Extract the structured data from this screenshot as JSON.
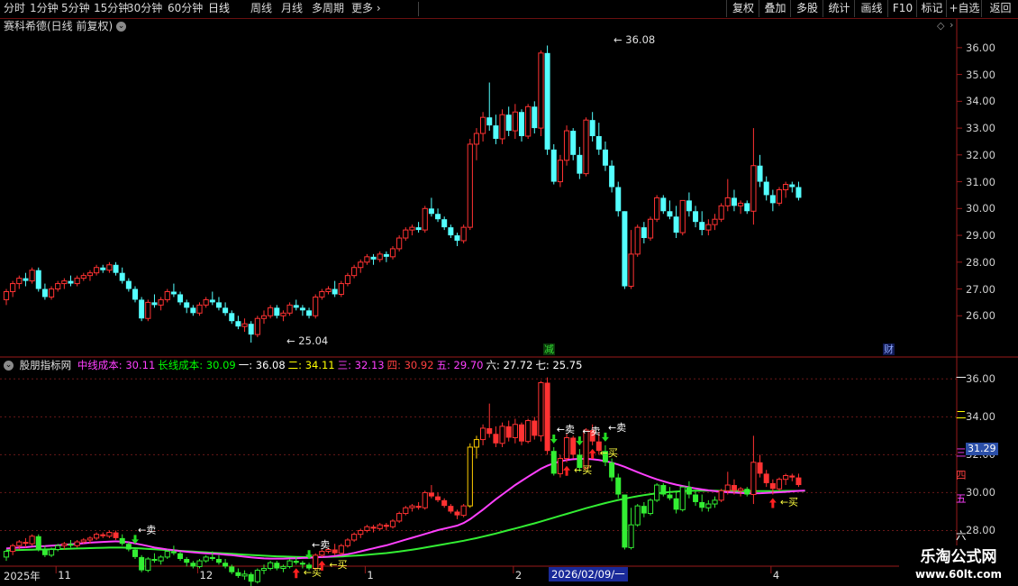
{
  "toolbar": {
    "periods": [
      "分时",
      "1分钟",
      "5分钟",
      "15分钟",
      "30分钟",
      "60分钟",
      "日线",
      "周线",
      "月线",
      "多周期",
      "更多"
    ],
    "active_period": "日线",
    "more_arrow": "›",
    "right_buttons": [
      "复权",
      "叠加",
      "多股",
      "统计",
      "画线",
      "F10",
      "标记",
      "+自选",
      "返回"
    ]
  },
  "main_panel": {
    "title": "赛科希德(日线 前复权)",
    "high_label": "36.08",
    "low_label": "25.04",
    "y_ticks": [
      "36.00",
      "35.00",
      "34.00",
      "33.00",
      "32.00",
      "31.00",
      "30.00",
      "29.00",
      "28.00",
      "27.00",
      "26.00"
    ],
    "event_tags": [
      "减",
      "财"
    ]
  },
  "indicator_panel": {
    "name": "股朋指标网",
    "values": [
      {
        "label": "中线成本:",
        "value": "30.11",
        "color": "#ff40ff"
      },
      {
        "label": "长线成本:",
        "value": "30.09",
        "color": "#00ff00"
      },
      {
        "label": "一:",
        "value": "36.08",
        "color": "#ffffff"
      },
      {
        "label": "二:",
        "value": "34.11",
        "color": "#ffff00"
      },
      {
        "label": "三:",
        "value": "32.13",
        "color": "#ff40ff"
      },
      {
        "label": "四:",
        "value": "30.92",
        "color": "#ff4040"
      },
      {
        "label": "五:",
        "value": "29.70",
        "color": "#ff40ff"
      },
      {
        "label": "六:",
        "value": "27.72",
        "color": "#ffffff"
      },
      {
        "label": "七:",
        "value": "25.75",
        "color": "#ffffff"
      }
    ],
    "y_ticks": [
      "36.00",
      "34.00",
      "32.00",
      "30.00",
      "28.00"
    ],
    "level_labels": [
      "一",
      "二",
      "三",
      "四",
      "五",
      "六"
    ],
    "current_price_badge": "31.29",
    "buy_label": "买",
    "sell_label": "卖"
  },
  "x_axis": {
    "labels": [
      "2025年",
      "11",
      "12",
      "1",
      "2",
      "4"
    ],
    "cursor_date": "2026/02/09/一"
  },
  "watermark": {
    "line1": "乐淘公式网",
    "line2": "www.60lt.com"
  },
  "colors": {
    "up": "#ff3232",
    "down": "#54ffff",
    "mid_cost": "#ff40ff",
    "long_cost": "#33ee33",
    "grid_red": "#8a1a1a",
    "axis_text": "#d0d0d0"
  },
  "chart_data": {
    "type": "candlestick",
    "ohlc": [
      [
        26.6,
        27.0,
        26.4,
        26.9
      ],
      [
        26.9,
        27.3,
        26.7,
        27.2
      ],
      [
        27.2,
        27.5,
        27.0,
        27.4
      ],
      [
        27.4,
        27.6,
        27.1,
        27.3
      ],
      [
        27.3,
        27.8,
        27.2,
        27.7
      ],
      [
        27.7,
        27.8,
        26.9,
        27.0
      ],
      [
        27.0,
        27.2,
        26.6,
        26.7
      ],
      [
        26.7,
        27.1,
        26.6,
        27.0
      ],
      [
        27.0,
        27.3,
        26.9,
        27.2
      ],
      [
        27.2,
        27.4,
        27.0,
        27.3
      ],
      [
        27.3,
        27.5,
        27.1,
        27.2
      ],
      [
        27.2,
        27.5,
        27.1,
        27.4
      ],
      [
        27.4,
        27.6,
        27.3,
        27.5
      ],
      [
        27.5,
        27.7,
        27.3,
        27.6
      ],
      [
        27.6,
        27.9,
        27.5,
        27.8
      ],
      [
        27.8,
        27.9,
        27.6,
        27.7
      ],
      [
        27.7,
        28.0,
        27.6,
        27.9
      ],
      [
        27.9,
        28.0,
        27.5,
        27.6
      ],
      [
        27.6,
        27.8,
        27.2,
        27.3
      ],
      [
        27.3,
        27.4,
        26.9,
        27.0
      ],
      [
        27.0,
        27.1,
        26.5,
        26.6
      ],
      [
        26.6,
        26.7,
        25.8,
        25.9
      ],
      [
        25.9,
        26.6,
        25.8,
        26.5
      ],
      [
        26.5,
        26.8,
        26.3,
        26.4
      ],
      [
        26.4,
        26.7,
        26.2,
        26.6
      ],
      [
        26.6,
        27.0,
        26.5,
        26.9
      ],
      [
        26.9,
        27.2,
        26.7,
        26.8
      ],
      [
        26.8,
        26.9,
        26.4,
        26.5
      ],
      [
        26.5,
        26.6,
        26.1,
        26.3
      ],
      [
        26.3,
        26.4,
        26.0,
        26.1
      ],
      [
        26.1,
        26.5,
        26.0,
        26.4
      ],
      [
        26.4,
        26.7,
        26.3,
        26.6
      ],
      [
        26.6,
        26.9,
        26.4,
        26.5
      ],
      [
        26.5,
        26.7,
        26.2,
        26.3
      ],
      [
        26.3,
        26.5,
        26.0,
        26.1
      ],
      [
        26.1,
        26.2,
        25.7,
        25.8
      ],
      [
        25.8,
        26.0,
        25.5,
        25.6
      ],
      [
        25.6,
        25.9,
        25.4,
        25.7
      ],
      [
        25.7,
        25.8,
        25.0,
        25.3
      ],
      [
        25.3,
        26.0,
        25.2,
        25.9
      ],
      [
        25.9,
        26.2,
        25.7,
        26.0
      ],
      [
        26.0,
        26.4,
        25.9,
        26.3
      ],
      [
        26.3,
        26.4,
        25.9,
        26.0
      ],
      [
        26.0,
        26.2,
        25.8,
        26.1
      ],
      [
        26.1,
        26.5,
        26.0,
        26.4
      ],
      [
        26.4,
        26.6,
        26.2,
        26.3
      ],
      [
        26.3,
        26.4,
        26.0,
        26.2
      ],
      [
        26.2,
        26.3,
        25.9,
        26.0
      ],
      [
        26.0,
        26.8,
        25.9,
        26.7
      ],
      [
        26.7,
        27.0,
        26.6,
        26.9
      ],
      [
        26.9,
        27.1,
        26.8,
        27.0
      ],
      [
        27.0,
        27.3,
        26.7,
        26.8
      ],
      [
        26.8,
        27.3,
        26.7,
        27.2
      ],
      [
        27.2,
        27.6,
        27.1,
        27.5
      ],
      [
        27.5,
        27.9,
        27.4,
        27.8
      ],
      [
        27.8,
        28.1,
        27.6,
        28.0
      ],
      [
        28.0,
        28.3,
        27.9,
        28.2
      ],
      [
        28.2,
        28.3,
        27.9,
        28.1
      ],
      [
        28.1,
        28.4,
        28.0,
        28.3
      ],
      [
        28.3,
        28.4,
        28.0,
        28.2
      ],
      [
        28.2,
        28.6,
        28.1,
        28.5
      ],
      [
        28.5,
        29.0,
        28.4,
        28.9
      ],
      [
        28.9,
        29.3,
        28.8,
        29.2
      ],
      [
        29.2,
        29.4,
        29.0,
        29.3
      ],
      [
        29.3,
        29.5,
        29.1,
        29.2
      ],
      [
        29.2,
        30.1,
        29.1,
        30.0
      ],
      [
        30.0,
        30.4,
        29.7,
        29.8
      ],
      [
        29.8,
        30.0,
        29.5,
        29.6
      ],
      [
        29.6,
        29.7,
        29.2,
        29.3
      ],
      [
        29.3,
        29.4,
        28.9,
        29.0
      ],
      [
        29.0,
        29.1,
        28.6,
        28.8
      ],
      [
        28.8,
        29.4,
        28.7,
        29.3
      ],
      [
        29.3,
        32.6,
        29.2,
        32.4
      ],
      [
        32.4,
        33.0,
        31.8,
        32.8
      ],
      [
        32.8,
        33.6,
        32.5,
        33.4
      ],
      [
        33.4,
        34.7,
        32.9,
        33.1
      ],
      [
        33.1,
        33.5,
        32.4,
        32.6
      ],
      [
        32.6,
        33.7,
        32.4,
        33.5
      ],
      [
        33.5,
        33.8,
        32.7,
        32.9
      ],
      [
        32.9,
        33.9,
        32.6,
        33.6
      ],
      [
        33.6,
        33.7,
        32.5,
        32.7
      ],
      [
        32.7,
        33.9,
        32.6,
        33.8
      ],
      [
        33.8,
        34.0,
        32.8,
        33.0
      ],
      [
        33.0,
        35.9,
        32.7,
        35.8
      ],
      [
        35.8,
        36.08,
        32.0,
        32.2
      ],
      [
        32.2,
        32.4,
        30.9,
        31.0
      ],
      [
        31.0,
        32.0,
        30.8,
        31.8
      ],
      [
        31.8,
        33.1,
        31.6,
        32.9
      ],
      [
        32.9,
        33.0,
        31.8,
        32.0
      ],
      [
        32.0,
        32.3,
        31.1,
        31.3
      ],
      [
        31.3,
        33.4,
        31.2,
        33.3
      ],
      [
        33.3,
        33.6,
        32.5,
        32.7
      ],
      [
        32.7,
        33.2,
        32.0,
        32.2
      ],
      [
        32.2,
        32.5,
        31.4,
        31.6
      ],
      [
        31.6,
        31.8,
        30.6,
        30.8
      ],
      [
        30.8,
        31.0,
        29.7,
        29.9
      ],
      [
        29.9,
        29.9,
        27.0,
        27.1
      ],
      [
        27.1,
        29.2,
        27.0,
        28.3
      ],
      [
        28.3,
        29.4,
        28.2,
        29.3
      ],
      [
        29.3,
        29.5,
        28.7,
        28.9
      ],
      [
        28.9,
        29.7,
        28.8,
        29.6
      ],
      [
        29.6,
        30.5,
        29.5,
        30.4
      ],
      [
        30.4,
        30.5,
        29.8,
        29.9
      ],
      [
        29.9,
        30.3,
        29.6,
        29.7
      ],
      [
        29.7,
        30.1,
        28.9,
        29.1
      ],
      [
        29.1,
        30.3,
        29.0,
        30.3
      ],
      [
        30.3,
        30.6,
        29.7,
        29.9
      ],
      [
        29.9,
        30.1,
        29.3,
        29.5
      ],
      [
        29.5,
        29.9,
        29.0,
        29.2
      ],
      [
        29.2,
        29.6,
        29.0,
        29.4
      ],
      [
        29.4,
        29.8,
        29.2,
        29.6
      ],
      [
        29.6,
        30.2,
        29.5,
        30.1
      ],
      [
        30.1,
        31.1,
        29.9,
        30.4
      ],
      [
        30.4,
        30.7,
        29.9,
        30.1
      ],
      [
        30.1,
        30.3,
        29.8,
        30.2
      ],
      [
        30.2,
        30.3,
        29.8,
        29.9
      ],
      [
        29.9,
        33.0,
        29.4,
        31.6
      ],
      [
        31.6,
        32.0,
        30.8,
        31.0
      ],
      [
        31.0,
        31.2,
        30.3,
        30.5
      ],
      [
        30.5,
        30.7,
        29.9,
        30.2
      ],
      [
        30.2,
        30.8,
        30.1,
        30.7
      ],
      [
        30.7,
        31.0,
        30.4,
        30.9
      ],
      [
        30.9,
        31.0,
        30.6,
        30.8
      ],
      [
        30.8,
        31.0,
        30.3,
        30.4
      ]
    ],
    "mid_cost": [
      27.05,
      27.08,
      27.1,
      27.12,
      27.15,
      27.17,
      27.18,
      27.2,
      27.22,
      27.25,
      27.28,
      27.3,
      27.33,
      27.36,
      27.38,
      27.4,
      27.42,
      27.43,
      27.42,
      27.38,
      27.32,
      27.25,
      27.18,
      27.1,
      27.05,
      27.0,
      26.96,
      26.92,
      26.88,
      26.85,
      26.82,
      26.8,
      26.78,
      26.76,
      26.73,
      26.7,
      26.66,
      26.62,
      26.58,
      26.55,
      26.53,
      26.52,
      26.52,
      26.52,
      26.53,
      26.54,
      26.55,
      26.56,
      26.58,
      26.6,
      26.62,
      26.65,
      26.7,
      26.75,
      26.82,
      26.9,
      26.98,
      27.06,
      27.14,
      27.22,
      27.32,
      27.42,
      27.52,
      27.62,
      27.72,
      27.82,
      27.92,
      28.02,
      28.1,
      28.18,
      28.26,
      28.4,
      28.6,
      28.85,
      29.1,
      29.38,
      29.65,
      29.9,
      30.15,
      30.4,
      30.62,
      30.84,
      31.05,
      31.26,
      31.42,
      31.55,
      31.65,
      31.72,
      31.76,
      31.78,
      31.78,
      31.76,
      31.72,
      31.66,
      31.58,
      31.48,
      31.36,
      31.22,
      31.08,
      30.95,
      30.82,
      30.7,
      30.6,
      30.5,
      30.42,
      30.35,
      30.28,
      30.22,
      30.17,
      30.12,
      30.08,
      30.05,
      30.02,
      30.0,
      29.98,
      29.97,
      29.96,
      29.97,
      29.98,
      30.0,
      30.02,
      30.04,
      30.07,
      30.09,
      30.11
    ],
    "long_cost": [
      26.95,
      26.96,
      26.97,
      26.98,
      26.99,
      27.0,
      27.0,
      27.01,
      27.02,
      27.03,
      27.04,
      27.05,
      27.06,
      27.07,
      27.08,
      27.09,
      27.1,
      27.1,
      27.1,
      27.09,
      27.07,
      27.05,
      27.03,
      27.01,
      26.99,
      26.97,
      26.95,
      26.93,
      26.91,
      26.89,
      26.87,
      26.85,
      26.83,
      26.81,
      26.79,
      26.77,
      26.75,
      26.73,
      26.71,
      26.69,
      26.67,
      26.65,
      26.64,
      26.63,
      26.62,
      26.61,
      26.6,
      26.6,
      26.6,
      26.6,
      26.61,
      26.62,
      26.63,
      26.65,
      26.67,
      26.69,
      26.72,
      26.75,
      26.78,
      26.81,
      26.85,
      26.89,
      26.94,
      26.99,
      27.04,
      27.1,
      27.16,
      27.22,
      27.28,
      27.34,
      27.4,
      27.46,
      27.53,
      27.6,
      27.68,
      27.76,
      27.84,
      27.93,
      28.02,
      28.11,
      28.2,
      28.29,
      28.38,
      28.48,
      28.58,
      28.68,
      28.78,
      28.88,
      28.98,
      29.08,
      29.18,
      29.27,
      29.36,
      29.45,
      29.53,
      29.61,
      29.68,
      29.75,
      29.81,
      29.87,
      29.92,
      29.96,
      30.0,
      30.03,
      30.06,
      30.08,
      30.09,
      30.1,
      30.1,
      30.1,
      30.1,
      30.09,
      30.09,
      30.09,
      30.08,
      30.08,
      30.08,
      30.08,
      30.08,
      30.08,
      30.08,
      30.09,
      30.09,
      30.09,
      30.09
    ],
    "main_ylim": [
      25.0,
      36.5
    ],
    "indicator_ylim": [
      26.5,
      36.3
    ],
    "buy_signals": [
      45,
      49,
      87,
      91,
      119
    ],
    "sell_signals": [
      20,
      47,
      85,
      89,
      93
    ]
  }
}
